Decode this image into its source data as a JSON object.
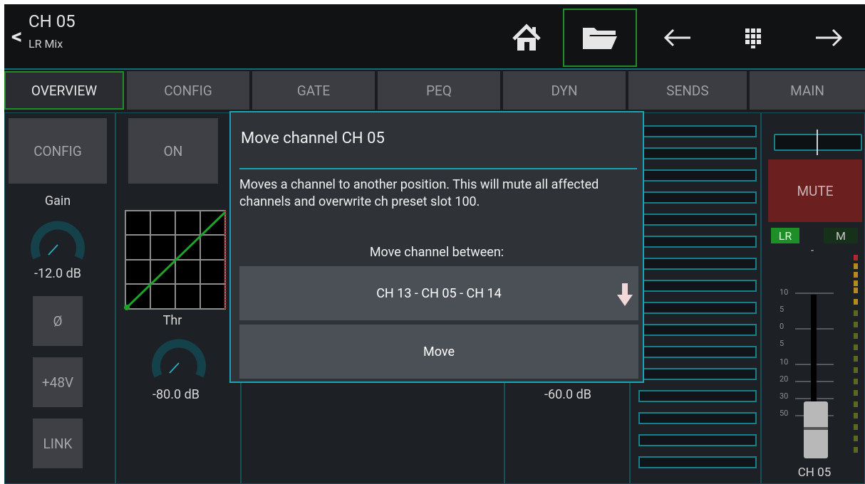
{
  "header": {
    "channel": "CH 05",
    "subtitle": "LR Mix",
    "icons": [
      "chevron-left-icon",
      "home-icon",
      "folder-icon",
      "arrow-left-icon",
      "grid-icon",
      "arrow-right-icon"
    ]
  },
  "tabs": [
    "OVERVIEW",
    "CONFIG",
    "GATE",
    "PEQ",
    "DYN",
    "SENDS",
    "MAIN"
  ],
  "left_panel": {
    "config_btn": "CONFIG",
    "gain_label": "Gain",
    "gain_value": "-12.0 dB",
    "phase_btn": "Ø",
    "phantom_btn": "+48V",
    "link_btn": "LINK"
  },
  "gate_panel": {
    "on_btn": "ON",
    "thr_label": "Thr",
    "thr_value": "-80.0 dB"
  },
  "dyn_panel": {
    "value": "-60.0 dB"
  },
  "main_panel": {
    "mute": "MUTE",
    "lr": "LR",
    "m": "M",
    "dash": "-",
    "scale": [
      "10",
      "5",
      "0",
      "5",
      "10",
      "20",
      "30",
      "50"
    ],
    "channel": "CH 05"
  },
  "dialog": {
    "title": "Move channel CH 05",
    "message": "Moves a channel to another position. This will mute all affected channels and overwrite ch preset slot 100.",
    "prompt": "Move channel between:",
    "selection": "CH 13 - CH 05 - CH 14",
    "move_btn": "Move"
  },
  "colors": {
    "accent": "#19a3b4",
    "active_green": "#1e8f26",
    "mute_red": "#6b1f1f"
  }
}
